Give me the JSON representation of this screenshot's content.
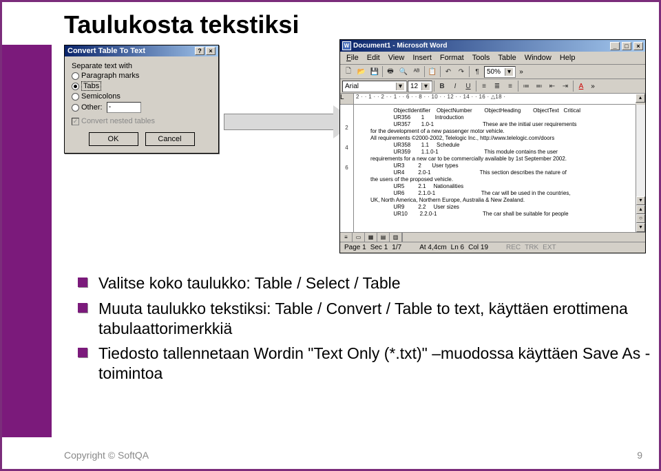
{
  "title": "Taulukosta tekstiksi",
  "dialog": {
    "title": "Convert Table To Text",
    "help_icon": "?",
    "close_icon": "×",
    "group_label": "Separate text with",
    "radios": {
      "para": "Paragraph marks",
      "tabs": "Tabs",
      "semi": "Semicolons",
      "other": "Other:"
    },
    "other_value": "-",
    "nested_check": "✓",
    "nested_label": "Convert nested tables",
    "ok": "OK",
    "cancel": "Cancel"
  },
  "word": {
    "app_icon": "W",
    "title": "Document1 - Microsoft Word",
    "menu": {
      "file": "File",
      "edit": "Edit",
      "view": "View",
      "insert": "Insert",
      "format": "Format",
      "tools": "Tools",
      "table": "Table",
      "window": "Window",
      "help": "Help"
    },
    "tb": {
      "new": "🗋",
      "open": "📂",
      "save": "💾",
      "print": "🖶",
      "preview": "🔍",
      "spell": "ᴬᴮ",
      "paste": "📋",
      "undo": "↶",
      "redo": "↷",
      "para": "¶",
      "zoom": "50%",
      "chev": "»"
    },
    "fmt": {
      "font": "Arial",
      "size": "12",
      "bold": "B",
      "italic": "I",
      "uline": "U",
      "alignL": "≡",
      "alignC": "≣",
      "alignR": "≡",
      "list1": "≔",
      "list2": "≕",
      "ind1": "⇤",
      "ind2": "⇥",
      "color": "A"
    },
    "ruler_corner": "L",
    "ruler_h": "  2 ·   · 1 ·   · 2 ·   · 1 ·   · 6 ·   · 8 ·   · 10 ·   · 12 ·   · 14 ·   · 16 ·  △18 ·",
    "ruler_v": [
      "",
      "2",
      "4",
      "6"
    ],
    "doc": "               ObjectIdentifier    ObjectNumber        ObjectHeading        ObjectText   Critical\n               UR356       1       Introduction\n               UR357       1.0-1                                These are the initial user requirements\nfor the development of a new passenger motor vehicle.\nAll requirements ©2000-2002, Telelogic Inc., http://www.telelogic.com/doors\n               UR358       1.1     Schedule\n               UR359       1.1.0-1                              This module contains the user\nrequirements for a new car to be commercially available by 1st September 2002.\n               UR3         2       User types\n               UR4         2.0-1                                This section describes the nature of\nthe users of the proposed vehicle.\n               UR5         2.1     Nationalities\n               UR6         2.1.0-1                              The car will be used in the countries,\nUK, North America, Northern Europe, Australia & New Zealand.\n               UR9         2.2     User sizes\n               UR10        2.2.0-1                              The car shall be suitable for people",
    "view_btns": [
      "≡",
      "▭",
      "▦",
      "▤",
      "▥"
    ],
    "status": {
      "page": "Page 1",
      "sec": "Sec 1",
      "pages": "1/7",
      "at": "At 4,4cm",
      "ln": "Ln 6",
      "col": "Col 19",
      "rec": "REC",
      "trk": "TRK",
      "ext": "EXT"
    }
  },
  "bullets": [
    "Valitse koko taulukko: Table / Select / Table",
    "Muuta taulukko tekstiksi: Table / Convert / Table to text, käyttäen erottimena tabulaattorimerkkiä",
    "Tiedosto tallennetaan Wordin \"Text Only (*.txt)\" –muodossa käyttäen Save As -toimintoa"
  ],
  "footer": {
    "left": "Copyright © SoftQA",
    "right": "9"
  }
}
